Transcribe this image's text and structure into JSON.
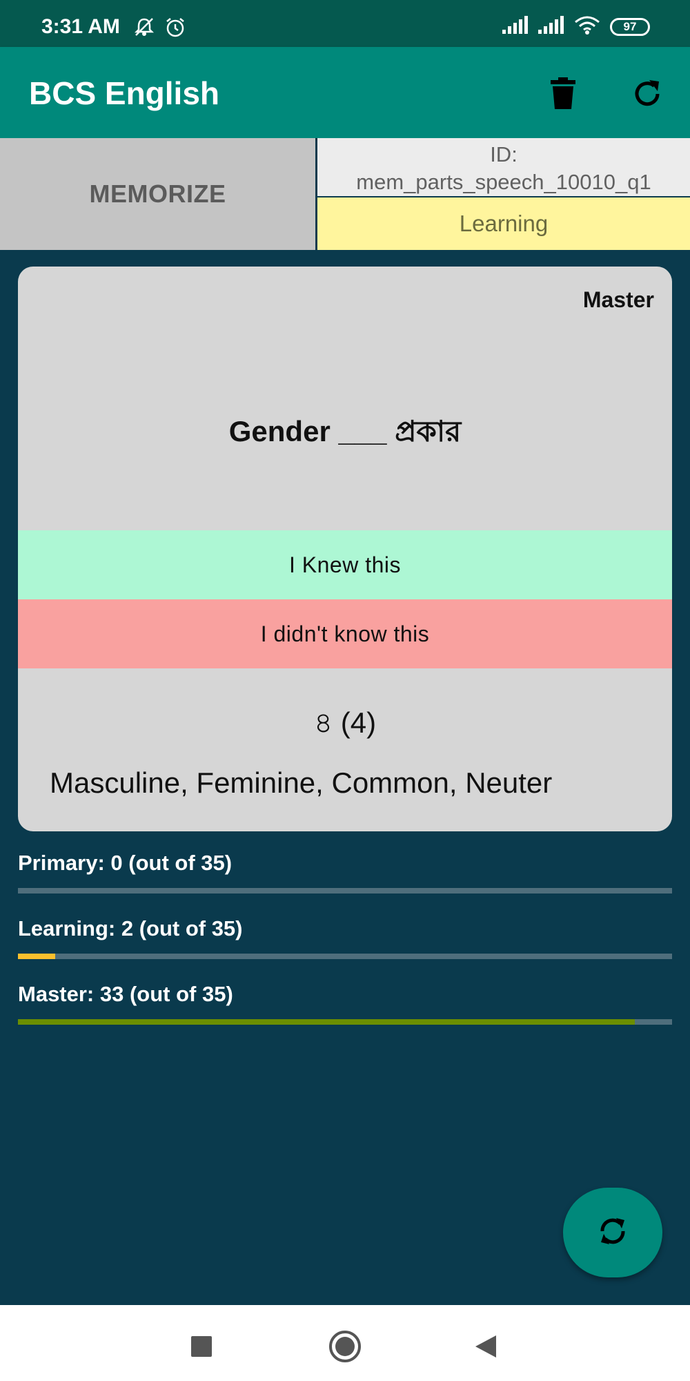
{
  "status_bar": {
    "time": "3:31 AM",
    "battery": "97",
    "icons": [
      "mute-notification-icon",
      "alarm-icon",
      "signal-icon",
      "signal-icon",
      "wifi-icon",
      "battery-icon"
    ]
  },
  "app_bar": {
    "title": "BCS English",
    "actions": [
      "delete-icon",
      "refresh-icon"
    ],
    "color": "#00897b"
  },
  "info_bar": {
    "mode_label": "MEMORIZE",
    "id_label": "ID:",
    "id_value": "mem_parts_speech_10010_q1",
    "status": "Learning"
  },
  "card": {
    "level": "Master",
    "question": "Gender ___ প্রকার",
    "knew_label": "I Knew this",
    "didnt_label": "I didn't know this",
    "count": "৪ (4)",
    "answer": "Masculine, Feminine, Common, Neuter"
  },
  "progress": [
    {
      "label": "Primary: 0 (out of 35)",
      "value": 0,
      "total": 35,
      "color": "#e0e0e0"
    },
    {
      "label": "Learning: 2 (out of 35)",
      "value": 2,
      "total": 35,
      "color": "#fbc02d"
    },
    {
      "label": "Master: 33 (out of 35)",
      "value": 33,
      "total": 35,
      "color": "#6b8e00"
    }
  ],
  "fab": {
    "icon": "sync-icon"
  },
  "nav_bar": {
    "icons": [
      "recents-icon",
      "home-icon",
      "back-icon"
    ]
  }
}
